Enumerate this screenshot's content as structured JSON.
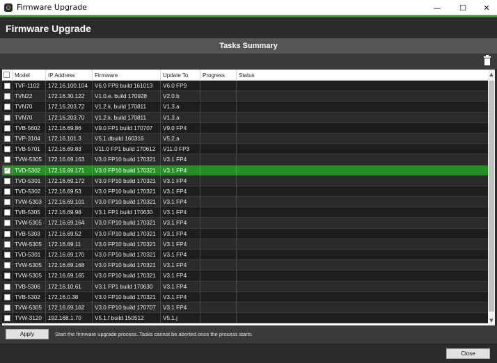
{
  "window": {
    "title": "Firmware Upgrade",
    "minimize_glyph": "—",
    "maximize_glyph": "☐",
    "close_glyph": "✕"
  },
  "header": {
    "title": "Firmware Upgrade"
  },
  "summary": {
    "title": "Tasks Summary"
  },
  "toolbar": {
    "delete_icon": "trash-icon"
  },
  "table": {
    "columns": [
      "Model",
      "IP Address",
      "Firmware",
      "Update To",
      "Progress",
      "Status"
    ],
    "rows": [
      {
        "model": "TVF-1102",
        "ip": "172.16.100.104",
        "firmware": "V6.0 FP8 build 161013",
        "update_to": "V6.0 FP9",
        "progress": "",
        "status": "",
        "checked": false
      },
      {
        "model": "TVN22",
        "ip": "172.16.30.122",
        "firmware": "V1.0.e. build 170928",
        "update_to": "V2.0.b",
        "progress": "",
        "status": "",
        "checked": false
      },
      {
        "model": "TVN70",
        "ip": "172.16.203.72",
        "firmware": "V1.2.k. build 170811",
        "update_to": "V1.3.a",
        "progress": "",
        "status": "",
        "checked": false
      },
      {
        "model": "TVN70",
        "ip": "172.16.203.70",
        "firmware": "V1.2.k. build 170811",
        "update_to": "V1.3.a",
        "progress": "",
        "status": "",
        "checked": false
      },
      {
        "model": "TVB-5602",
        "ip": "172.16.69.86",
        "firmware": "V9.0 FP1 build 170707",
        "update_to": "V9.0 FP4",
        "progress": "",
        "status": "",
        "checked": false
      },
      {
        "model": "TVP-3104",
        "ip": "172.16.101.3",
        "firmware": "V5.1.dbuild 160316",
        "update_to": "V5.2.a",
        "progress": "",
        "status": "",
        "checked": false
      },
      {
        "model": "TVB-5701",
        "ip": "172.16.69.83",
        "firmware": "V11.0 FP1 build 170612",
        "update_to": "V11.0 FP3",
        "progress": "",
        "status": "",
        "checked": false
      },
      {
        "model": "TVW-5305",
        "ip": "172.16.69.163",
        "firmware": "V3.0 FP10 build 170321",
        "update_to": "V3.1 FP4",
        "progress": "",
        "status": "",
        "checked": false
      },
      {
        "model": "TVD-5302",
        "ip": "172.16.69.171",
        "firmware": "V3.0 FP10 build 170321",
        "update_to": "V3.1 FP4",
        "progress": "",
        "status": "",
        "checked": true
      },
      {
        "model": "TVD-5301",
        "ip": "172.16.69.172",
        "firmware": "V3.0 FP10 build 170321",
        "update_to": "V3.1 FP4",
        "progress": "",
        "status": "",
        "checked": false
      },
      {
        "model": "TVD-5302",
        "ip": "172.16.69.53",
        "firmware": "V3.0 FP10 build 170321",
        "update_to": "V3.1 FP4",
        "progress": "",
        "status": "",
        "checked": false
      },
      {
        "model": "TVW-5303",
        "ip": "172.16.69.101",
        "firmware": "V3.0 FP10 build 170321",
        "update_to": "V3.1 FP4",
        "progress": "",
        "status": "",
        "checked": false
      },
      {
        "model": "TVB-5305",
        "ip": "172.16.69.98",
        "firmware": "V3.1 FP1 build 170630",
        "update_to": "V3.1 FP4",
        "progress": "",
        "status": "",
        "checked": false
      },
      {
        "model": "TVW-5305",
        "ip": "172.16.69.164",
        "firmware": "V3.0 FP10 build 170321",
        "update_to": "V3.1 FP4",
        "progress": "",
        "status": "",
        "checked": false
      },
      {
        "model": "TVB-5303",
        "ip": "172.16.69.52",
        "firmware": "V3.0 FP10 build 170321",
        "update_to": "V3.1 FP4",
        "progress": "",
        "status": "",
        "checked": false
      },
      {
        "model": "TVW-5305",
        "ip": "172.16.69.11",
        "firmware": "V3.0 FP10 build 170321",
        "update_to": "V3.1 FP4",
        "progress": "",
        "status": "",
        "checked": false
      },
      {
        "model": "TVD-5301",
        "ip": "172.16.69.170",
        "firmware": "V3.0 FP10 build 170321",
        "update_to": "V3.1 FP4",
        "progress": "",
        "status": "",
        "checked": false
      },
      {
        "model": "TVW-5305",
        "ip": "172.16.69.168",
        "firmware": "V3.0 FP10 build 170321",
        "update_to": "V3.1 FP4",
        "progress": "",
        "status": "",
        "checked": false
      },
      {
        "model": "TVW-5305",
        "ip": "172.16.69.165",
        "firmware": "V3.0 FP10 build 170321",
        "update_to": "V3.1 FP4",
        "progress": "",
        "status": "",
        "checked": false
      },
      {
        "model": "TVB-5306",
        "ip": "172.16.10.61",
        "firmware": "V3.1 FP1 build 170630",
        "update_to": "V3.1 FP4",
        "progress": "",
        "status": "",
        "checked": false
      },
      {
        "model": "TVB-5302",
        "ip": "172.16.0.38",
        "firmware": "V3.0 FP10 build 170321",
        "update_to": "V3.1 FP4",
        "progress": "",
        "status": "",
        "checked": false
      },
      {
        "model": "TVW-5305",
        "ip": "172.16.69.162",
        "firmware": "V3.0 FP10 build 170707",
        "update_to": "V3.1 FP4",
        "progress": "",
        "status": "",
        "checked": false
      },
      {
        "model": "TVW-3120",
        "ip": "192.168.1.70",
        "firmware": "V5.1.f build 150512",
        "update_to": "V5.1.j",
        "progress": "",
        "status": "",
        "checked": false
      }
    ]
  },
  "footer": {
    "apply_label": "Apply",
    "note": "Start the firmware upgrade process.  Tasks cannot be aborted once the process starts.",
    "close_label": "Close"
  },
  "colors": {
    "selected_row": "#239022",
    "accent_line": "#3c9a2a"
  }
}
